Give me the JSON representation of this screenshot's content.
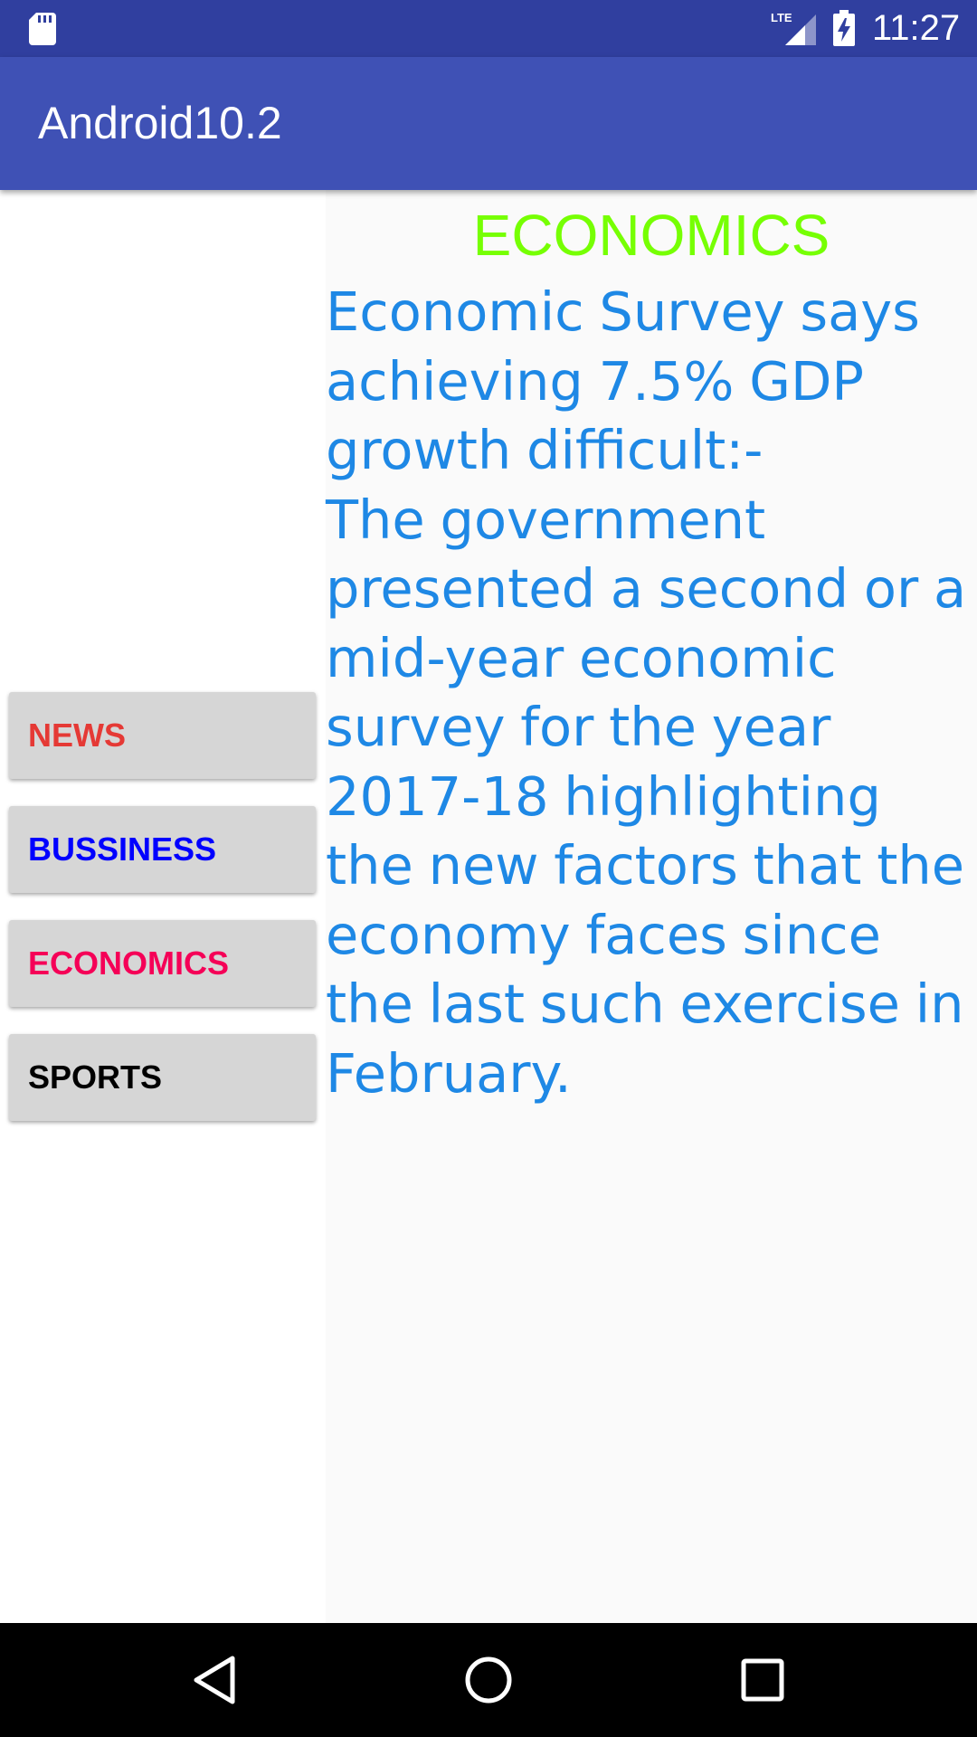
{
  "status_bar": {
    "time": "11:27",
    "network_label": "LTE",
    "icons": [
      "sd-card-icon",
      "signal-icon",
      "battery-charging-icon"
    ]
  },
  "app_bar": {
    "title": "Android10.2"
  },
  "menu": {
    "items": [
      {
        "label": "NEWS",
        "color": "#E53935"
      },
      {
        "label": "BUSSINESS",
        "color": "#0000FF"
      },
      {
        "label": "ECONOMICS",
        "color": "#F50057"
      },
      {
        "label": "SPORTS",
        "color": "#000000"
      }
    ]
  },
  "detail": {
    "title": "ECONOMICS",
    "title_color": "#76FF03",
    "body": "Economic Survey says achieving 7.5% GDP growth difficult:-\nThe government presented a second or a mid-year economic survey for the year 2017-18 highlighting the new factors that the economy faces since the last such exercise in February.",
    "body_color": "#1E88E5"
  },
  "nav_bar": {
    "icons": [
      "back-icon",
      "home-icon",
      "recents-icon"
    ]
  },
  "colors": {
    "status_bar": "#303F9F",
    "app_bar": "#3F51B5",
    "button_bg": "#D6D6D6"
  }
}
